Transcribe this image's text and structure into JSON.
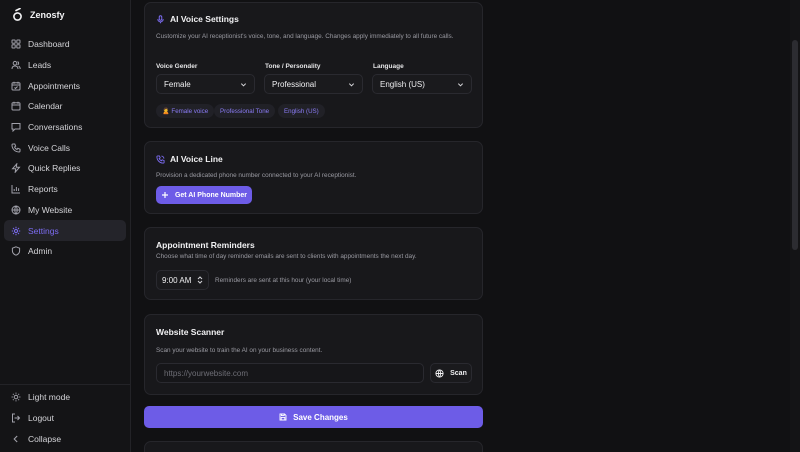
{
  "app": {
    "name": "Zenosfy"
  },
  "sidebar": {
    "items": [
      {
        "label": "Dashboard",
        "icon": "grid-icon"
      },
      {
        "label": "Leads",
        "icon": "users-icon"
      },
      {
        "label": "Appointments",
        "icon": "calendar-check-icon"
      },
      {
        "label": "Calendar",
        "icon": "calendar-icon"
      },
      {
        "label": "Conversations",
        "icon": "message-icon"
      },
      {
        "label": "Voice Calls",
        "icon": "phone-icon"
      },
      {
        "label": "Quick Replies",
        "icon": "zap-icon"
      },
      {
        "label": "Reports",
        "icon": "bar-chart-icon"
      },
      {
        "label": "My Website",
        "icon": "globe-icon"
      },
      {
        "label": "Settings",
        "icon": "gear-icon",
        "active": true
      },
      {
        "label": "Admin",
        "icon": "shield-icon"
      }
    ],
    "bottom": {
      "light_mode": "Light mode",
      "logout": "Logout",
      "collapse": "Collapse"
    }
  },
  "voice_settings": {
    "title": "AI Voice Settings",
    "description": "Customize your AI receptionist's voice, tone, and language. Changes apply immediately to all future calls.",
    "gender_label": "Voice Gender",
    "gender_value": "Female",
    "tone_label": "Tone / Personality",
    "tone_value": "Professional",
    "language_label": "Language",
    "language_value": "English (US)",
    "chips": [
      "🙎 Female voice",
      "Professional Tone",
      "English (US)"
    ]
  },
  "voice_line": {
    "title": "AI Voice Line",
    "description": "Provision a dedicated phone number connected to your AI receptionist.",
    "button": "Get AI Phone Number"
  },
  "reminders": {
    "title": "Appointment Reminders",
    "description": "Choose what time of day reminder emails are sent to clients with appointments the next day.",
    "time_value": "9:00 AM",
    "note": "Reminders are sent at this hour (your local time)"
  },
  "scanner": {
    "title": "Website Scanner",
    "description": "Scan your website to train the AI on your business content.",
    "placeholder": "https://yourwebsite.com",
    "button": "Scan"
  },
  "save_button": "Save Changes",
  "colors": {
    "accent": "#6d5ce7",
    "accent_text": "#7c6cf2",
    "background": "#111113",
    "card": "#18181b"
  }
}
